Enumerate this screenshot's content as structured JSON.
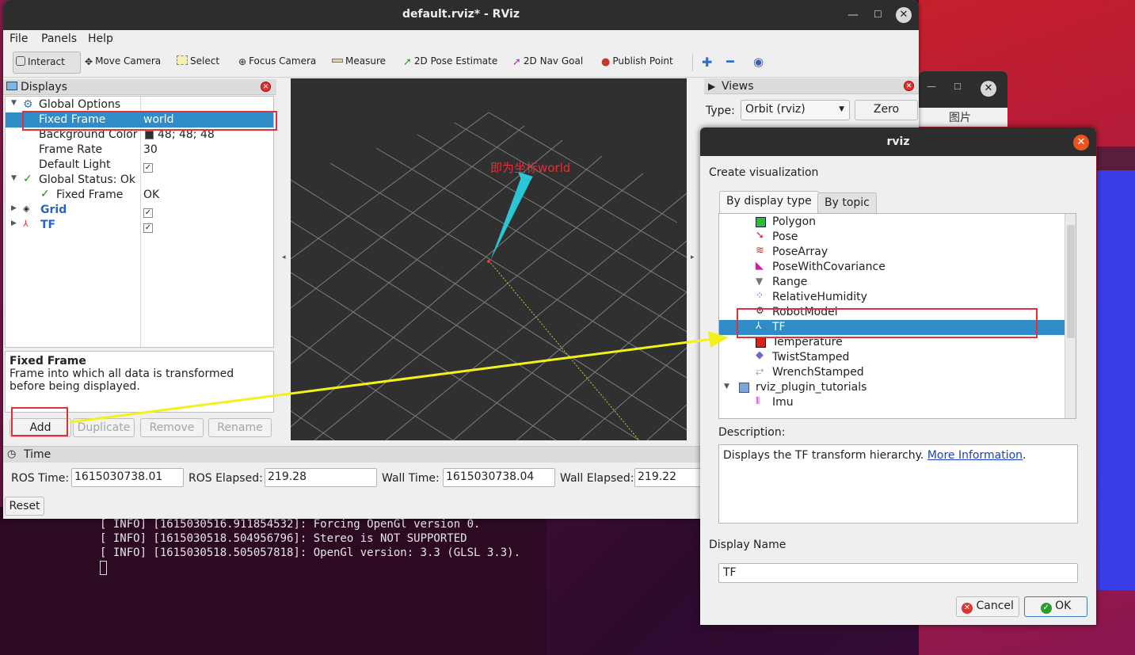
{
  "rviz_window": {
    "title": "default.rviz* - RViz",
    "menu": [
      "File",
      "Panels",
      "Help"
    ],
    "toolbar": [
      "Interact",
      "Move Camera",
      "Select",
      "Focus Camera",
      "Measure",
      "2D Pose Estimate",
      "2D Nav Goal",
      "Publish Point"
    ],
    "displays": {
      "title": "Displays",
      "rows": [
        {
          "label": "Global Options",
          "value": ""
        },
        {
          "label": "Fixed Frame",
          "value": "world"
        },
        {
          "label": "Background Color",
          "value": "48; 48; 48"
        },
        {
          "label": "Frame Rate",
          "value": "30"
        },
        {
          "label": "Default Light",
          "value": ""
        },
        {
          "label": "Global Status: Ok",
          "value": ""
        },
        {
          "label": "Fixed Frame",
          "value": "OK"
        },
        {
          "label": "Grid",
          "value": ""
        },
        {
          "label": "TF",
          "value": ""
        }
      ],
      "description_title": "Fixed Frame",
      "description_text": "Frame into which all data is transformed before being displayed.",
      "buttons": [
        "Add",
        "Duplicate",
        "Remove",
        "Rename"
      ]
    },
    "viewport": {
      "annotation": "即为坐标world",
      "background_color": "#303030"
    },
    "views": {
      "title": "Views",
      "type_label": "Type:",
      "type_value": "Orbit (rviz)",
      "zero_button": "Zero"
    },
    "time": {
      "title": "Time",
      "ros_time_label": "ROS Time:",
      "ros_time": "1615030738.01",
      "ros_elapsed_label": "ROS Elapsed:",
      "ros_elapsed": "219.28",
      "wall_time_label": "Wall Time:",
      "wall_time": "1615030738.04",
      "wall_elapsed_label": "Wall Elapsed:",
      "wall_elapsed": "219.22",
      "reset_button": "Reset"
    }
  },
  "terminal": {
    "lines": [
      "[ INFO] [1615030516.911854532]: Forcing OpenGl version 0.",
      "[ INFO] [1615030518.504956796]: Stereo is NOT SUPPORTED",
      "[ INFO] [1615030518.505057818]: OpenGl version: 3.3 (GLSL 3.3)."
    ]
  },
  "background_window": {
    "tab_label": "图片"
  },
  "dialog": {
    "title": "rviz",
    "create_label": "Create visualization",
    "tabs": [
      "By display type",
      "By topic"
    ],
    "items": [
      "Polygon",
      "Pose",
      "PoseArray",
      "PoseWithCovariance",
      "Range",
      "RelativeHumidity",
      "RobotModel",
      "TF",
      "Temperature",
      "TwistStamped",
      "WrenchStamped",
      "rviz_plugin_tutorials",
      "Imu"
    ],
    "description_label": "Description:",
    "description_text": "Displays the TF transform hierarchy.",
    "description_link": "More Information",
    "description_tail": ".",
    "display_name_label": "Display Name",
    "display_name_value": "TF",
    "cancel_button": "Cancel",
    "ok_button": "OK"
  },
  "colors": {
    "selection": "#308cc6",
    "annotation_red": "#e0303a",
    "arrow_cyan": "#2ac6d6",
    "arrow_yellow": "#f2f21a"
  }
}
